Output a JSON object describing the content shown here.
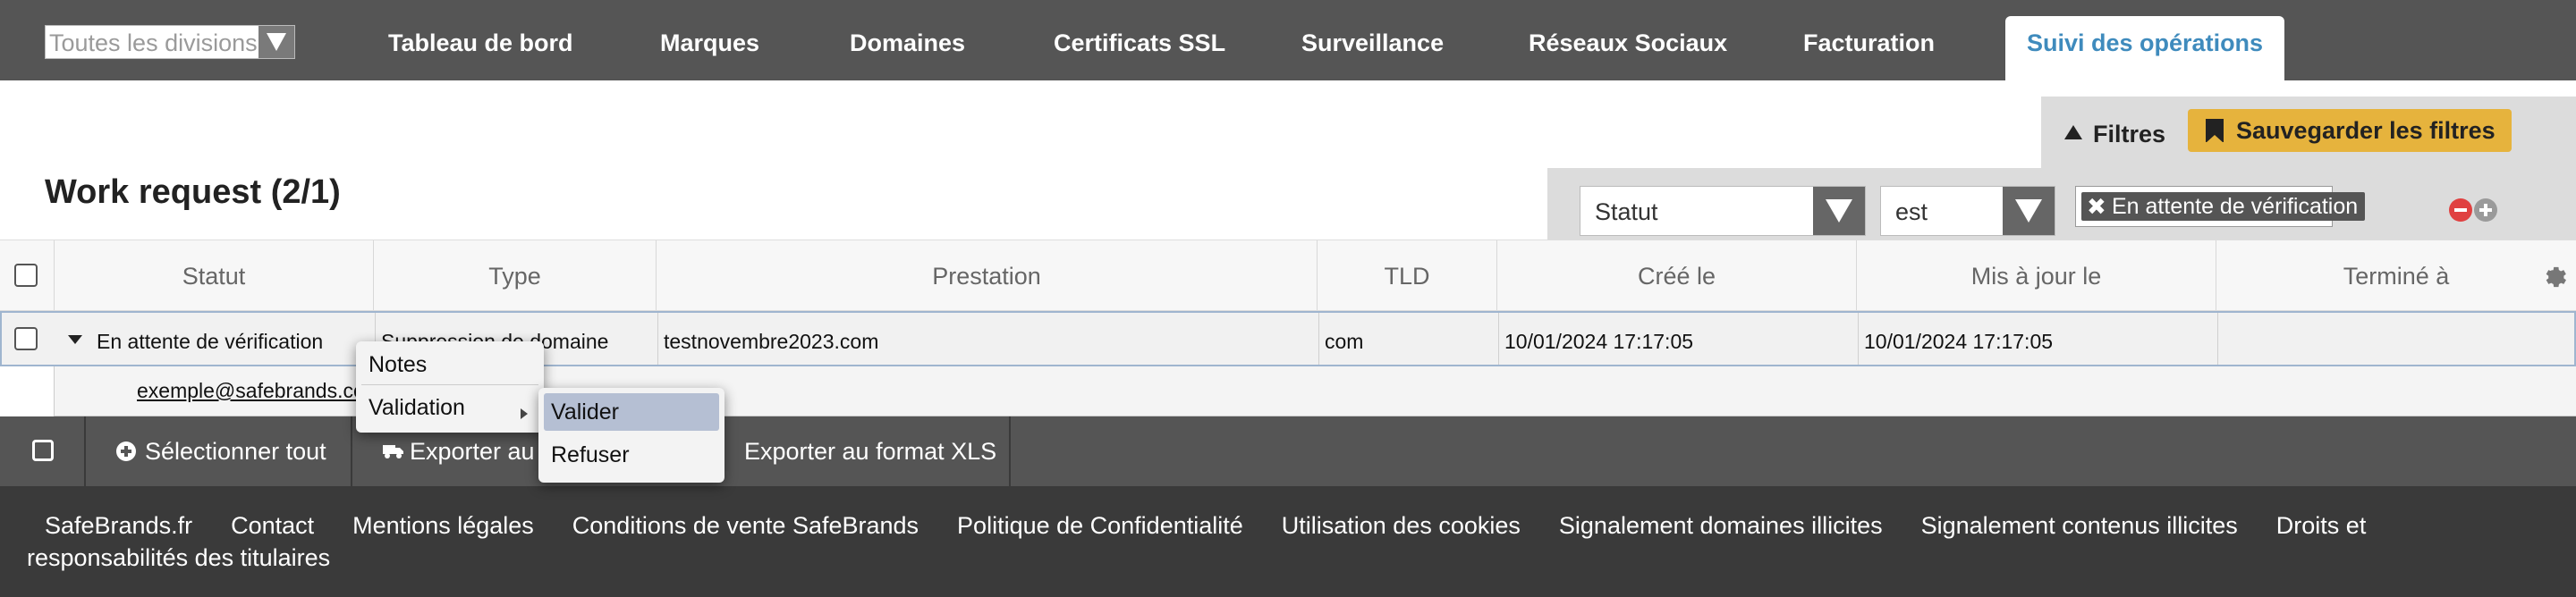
{
  "nav": {
    "division_select": "Toutes les divisions",
    "items": [
      "Tableau de bord",
      "Marques",
      "Domaines",
      "Certificats SSL",
      "Surveillance",
      "Réseaux Sociaux",
      "Facturation",
      "Suivi des opérations"
    ],
    "active": "Suivi des opérations",
    "active_color": "#3f8bbd"
  },
  "filters": {
    "label": "Filtres",
    "save_label": "Sauvegarder les filtres",
    "field": "Statut",
    "operator": "est",
    "value_tag": "En attente de vérification",
    "accent": "#e6b33d"
  },
  "page": {
    "title": "Work request  (2/1)"
  },
  "table": {
    "columns": [
      "Statut",
      "Type",
      "Prestation",
      "TLD",
      "Créé le",
      "Mis à jour le",
      "Terminé à"
    ],
    "rows": [
      {
        "statut": "En attente de vérification",
        "type": "Suppression de domaine",
        "prestation": "testnovembre2023.com",
        "tld": "com",
        "cree_le": "10/01/2024 17:17:05",
        "mis_a_jour_le": "10/01/2024 17:17:05",
        "termine_a": "",
        "email": "exemple@safebrands.com"
      }
    ]
  },
  "context_menu": {
    "items": [
      "Notes",
      "Validation"
    ],
    "submenu": [
      "Valider",
      "Refuser"
    ]
  },
  "actions": {
    "select_all": "Sélectionner tout",
    "export_1": "Exporter au f",
    "export_xls": "Exporter au format XLS"
  },
  "footer": {
    "links": [
      "SafeBrands.fr",
      "Contact",
      "Mentions légales",
      "Conditions de vente SafeBrands",
      "Politique de Confidentialité",
      "Utilisation des cookies",
      "Signalement domaines illicites",
      "Signalement contenus illicites",
      "Droits et responsabilités des titulaires"
    ]
  }
}
